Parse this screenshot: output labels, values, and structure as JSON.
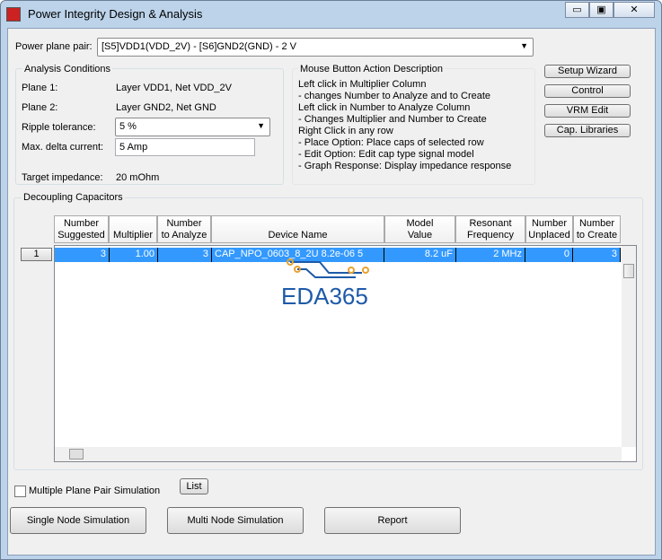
{
  "window": {
    "title": "Power Integrity Design & Analysis",
    "minimize": "▭",
    "maximize": "▣",
    "close": "✕"
  },
  "plane_pair": {
    "label": "Power plane pair:",
    "value": "[S5]VDD1(VDD_2V) - [S6]GND2(GND) - 2 V"
  },
  "analysis": {
    "title": "Analysis Conditions",
    "plane1_label": "Plane 1:",
    "plane1_value": "Layer VDD1, Net VDD_2V",
    "plane2_label": "Plane 2:",
    "plane2_value": "Layer GND2, Net GND",
    "ripple_label": "Ripple tolerance:",
    "ripple_value": "5 %",
    "delta_label": "Max. delta current:",
    "delta_value": "5 Amp",
    "target_label": "Target impedance:",
    "target_value": "20 mOhm"
  },
  "mouse": {
    "title": "Mouse Button Action Description",
    "lines": [
      "Left click in Multiplier Column",
      "- changes Number to Analyze and to Create",
      "Left click in Number to Analyze Column",
      "- Changes Multiplier and Number to Create",
      "Right Click in any row",
      "- Place Option: Place caps of selected row",
      "- Edit Option: Edit cap type signal model",
      "- Graph Response: Display impedance response"
    ]
  },
  "side_buttons": [
    "Setup Wizard",
    "Control",
    "VRM Edit",
    "Cap. Libraries"
  ],
  "decoupling": {
    "title": "Decoupling Capacitors",
    "columns": [
      [
        "Number",
        "Suggested"
      ],
      [
        "",
        "Multiplier"
      ],
      [
        "Number",
        "to Analyze"
      ],
      [
        "",
        "Device Name"
      ],
      [
        "Model",
        "Value"
      ],
      [
        "Resonant",
        "Frequency"
      ],
      [
        "Number",
        "Unplaced"
      ],
      [
        "Number",
        "to Create"
      ]
    ],
    "rows": [
      {
        "index": "1",
        "cells": [
          "3",
          "1.00",
          "3",
          "CAP_NPO_0603_8_2U 8.2e-06 5",
          "8.2 uF",
          "2 MHz",
          "0",
          "3"
        ]
      }
    ]
  },
  "watermark": "EDA365",
  "multi_plane": {
    "label": "Multiple Plane Pair Simulation",
    "checked": false
  },
  "list_button": "List",
  "bottom_buttons": [
    "Single Node Simulation",
    "Multi Node Simulation",
    "Report"
  ]
}
